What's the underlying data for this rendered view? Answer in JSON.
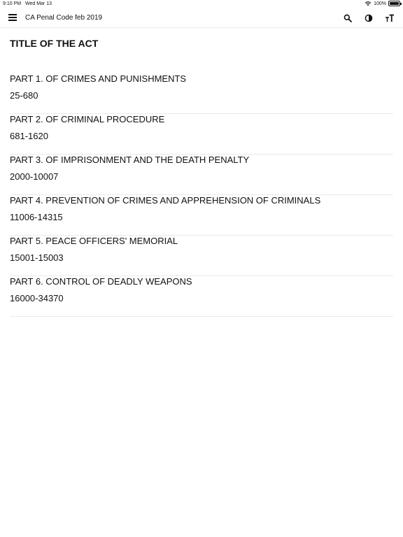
{
  "status_bar": {
    "time": "9:10 PM",
    "date": "Wed Mar 13",
    "battery": "100%"
  },
  "app_bar": {
    "title": "CA Penal Code feb 2019",
    "icons": [
      "menu-icon",
      "search-icon",
      "contrast-icon",
      "text-size-icon"
    ]
  },
  "section": {
    "title": "TITLE OF THE ACT"
  },
  "parts": [
    {
      "title": "PART 1. OF CRIMES AND PUNISHMENTS",
      "range": "25-680"
    },
    {
      "title": "PART 2. OF CRIMINAL PROCEDURE",
      "range": "681-1620"
    },
    {
      "title": "PART 3. OF IMPRISONMENT AND THE DEATH PENALTY",
      "range": "2000-10007"
    },
    {
      "title": "PART 4. PREVENTION OF CRIMES AND APPREHENSION OF CRIMINALS",
      "range": "11006-14315"
    },
    {
      "title": "PART 5. PEACE OFFICERS' MEMORIAL",
      "range": "15001-15003"
    },
    {
      "title": "PART 6. CONTROL OF DEADLY WEAPONS",
      "range": "16000-34370"
    }
  ]
}
